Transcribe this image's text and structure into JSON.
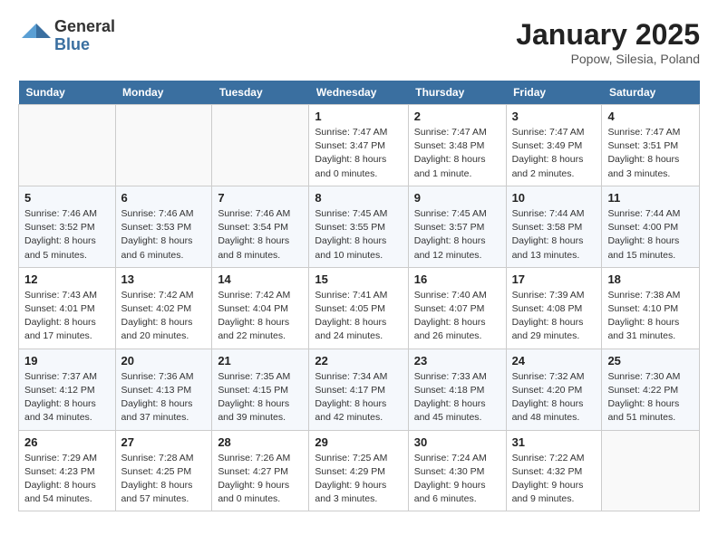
{
  "header": {
    "logo_general": "General",
    "logo_blue": "Blue",
    "month_title": "January 2025",
    "location": "Popow, Silesia, Poland"
  },
  "weekdays": [
    "Sunday",
    "Monday",
    "Tuesday",
    "Wednesday",
    "Thursday",
    "Friday",
    "Saturday"
  ],
  "weeks": [
    [
      {
        "day": "",
        "info": ""
      },
      {
        "day": "",
        "info": ""
      },
      {
        "day": "",
        "info": ""
      },
      {
        "day": "1",
        "info": "Sunrise: 7:47 AM\nSunset: 3:47 PM\nDaylight: 8 hours\nand 0 minutes."
      },
      {
        "day": "2",
        "info": "Sunrise: 7:47 AM\nSunset: 3:48 PM\nDaylight: 8 hours\nand 1 minute."
      },
      {
        "day": "3",
        "info": "Sunrise: 7:47 AM\nSunset: 3:49 PM\nDaylight: 8 hours\nand 2 minutes."
      },
      {
        "day": "4",
        "info": "Sunrise: 7:47 AM\nSunset: 3:51 PM\nDaylight: 8 hours\nand 3 minutes."
      }
    ],
    [
      {
        "day": "5",
        "info": "Sunrise: 7:46 AM\nSunset: 3:52 PM\nDaylight: 8 hours\nand 5 minutes."
      },
      {
        "day": "6",
        "info": "Sunrise: 7:46 AM\nSunset: 3:53 PM\nDaylight: 8 hours\nand 6 minutes."
      },
      {
        "day": "7",
        "info": "Sunrise: 7:46 AM\nSunset: 3:54 PM\nDaylight: 8 hours\nand 8 minutes."
      },
      {
        "day": "8",
        "info": "Sunrise: 7:45 AM\nSunset: 3:55 PM\nDaylight: 8 hours\nand 10 minutes."
      },
      {
        "day": "9",
        "info": "Sunrise: 7:45 AM\nSunset: 3:57 PM\nDaylight: 8 hours\nand 12 minutes."
      },
      {
        "day": "10",
        "info": "Sunrise: 7:44 AM\nSunset: 3:58 PM\nDaylight: 8 hours\nand 13 minutes."
      },
      {
        "day": "11",
        "info": "Sunrise: 7:44 AM\nSunset: 4:00 PM\nDaylight: 8 hours\nand 15 minutes."
      }
    ],
    [
      {
        "day": "12",
        "info": "Sunrise: 7:43 AM\nSunset: 4:01 PM\nDaylight: 8 hours\nand 17 minutes."
      },
      {
        "day": "13",
        "info": "Sunrise: 7:42 AM\nSunset: 4:02 PM\nDaylight: 8 hours\nand 20 minutes."
      },
      {
        "day": "14",
        "info": "Sunrise: 7:42 AM\nSunset: 4:04 PM\nDaylight: 8 hours\nand 22 minutes."
      },
      {
        "day": "15",
        "info": "Sunrise: 7:41 AM\nSunset: 4:05 PM\nDaylight: 8 hours\nand 24 minutes."
      },
      {
        "day": "16",
        "info": "Sunrise: 7:40 AM\nSunset: 4:07 PM\nDaylight: 8 hours\nand 26 minutes."
      },
      {
        "day": "17",
        "info": "Sunrise: 7:39 AM\nSunset: 4:08 PM\nDaylight: 8 hours\nand 29 minutes."
      },
      {
        "day": "18",
        "info": "Sunrise: 7:38 AM\nSunset: 4:10 PM\nDaylight: 8 hours\nand 31 minutes."
      }
    ],
    [
      {
        "day": "19",
        "info": "Sunrise: 7:37 AM\nSunset: 4:12 PM\nDaylight: 8 hours\nand 34 minutes."
      },
      {
        "day": "20",
        "info": "Sunrise: 7:36 AM\nSunset: 4:13 PM\nDaylight: 8 hours\nand 37 minutes."
      },
      {
        "day": "21",
        "info": "Sunrise: 7:35 AM\nSunset: 4:15 PM\nDaylight: 8 hours\nand 39 minutes."
      },
      {
        "day": "22",
        "info": "Sunrise: 7:34 AM\nSunset: 4:17 PM\nDaylight: 8 hours\nand 42 minutes."
      },
      {
        "day": "23",
        "info": "Sunrise: 7:33 AM\nSunset: 4:18 PM\nDaylight: 8 hours\nand 45 minutes."
      },
      {
        "day": "24",
        "info": "Sunrise: 7:32 AM\nSunset: 4:20 PM\nDaylight: 8 hours\nand 48 minutes."
      },
      {
        "day": "25",
        "info": "Sunrise: 7:30 AM\nSunset: 4:22 PM\nDaylight: 8 hours\nand 51 minutes."
      }
    ],
    [
      {
        "day": "26",
        "info": "Sunrise: 7:29 AM\nSunset: 4:23 PM\nDaylight: 8 hours\nand 54 minutes."
      },
      {
        "day": "27",
        "info": "Sunrise: 7:28 AM\nSunset: 4:25 PM\nDaylight: 8 hours\nand 57 minutes."
      },
      {
        "day": "28",
        "info": "Sunrise: 7:26 AM\nSunset: 4:27 PM\nDaylight: 9 hours\nand 0 minutes."
      },
      {
        "day": "29",
        "info": "Sunrise: 7:25 AM\nSunset: 4:29 PM\nDaylight: 9 hours\nand 3 minutes."
      },
      {
        "day": "30",
        "info": "Sunrise: 7:24 AM\nSunset: 4:30 PM\nDaylight: 9 hours\nand 6 minutes."
      },
      {
        "day": "31",
        "info": "Sunrise: 7:22 AM\nSunset: 4:32 PM\nDaylight: 9 hours\nand 9 minutes."
      },
      {
        "day": "",
        "info": ""
      }
    ]
  ]
}
